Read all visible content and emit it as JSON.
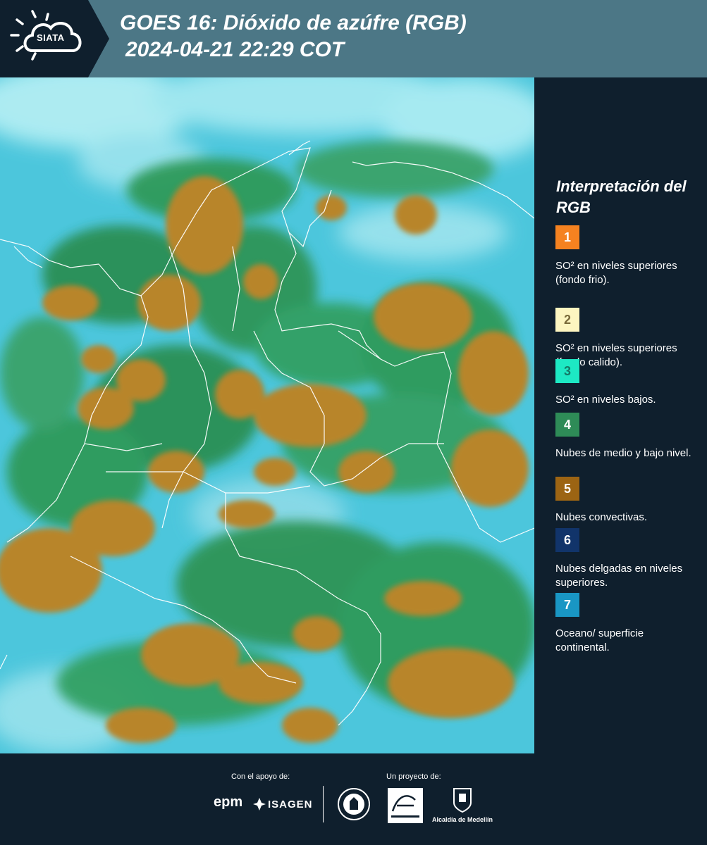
{
  "header": {
    "logo_text": "SIATA",
    "title_line_1": "GOES 16: Dióxido de azúfre (RGB)",
    "title_line_2": "2024-04-21 22:29 COT",
    "colors": {
      "dark": "#0f1f2d",
      "bar": "#4c7786"
    }
  },
  "map": {
    "product": "GOES-16 SO2 RGB composite",
    "dominant_colors": {
      "ocean_surface": "#5fd3e6",
      "mid_low_clouds": "#2f9a5a",
      "convective_clouds": "#b8852c"
    }
  },
  "legend": {
    "title": "Interpretación del RGB",
    "items": [
      {
        "number": "1",
        "color": "#f58220",
        "number_color": "#ffffff",
        "text": "SO² en niveles superiores (fondo frio)."
      },
      {
        "number": "2",
        "color": "#fdf5c0",
        "number_color": "#7a6a3a",
        "text": "SO² en niveles superiores (fondo calido)."
      },
      {
        "number": "3",
        "color": "#1de9c4",
        "number_color": "#147a66",
        "text": "SO² en niveles bajos."
      },
      {
        "number": "4",
        "color": "#2e8b57",
        "number_color": "#ffffff",
        "text": "Nubes de medio y bajo nivel."
      },
      {
        "number": "5",
        "color": "#9c6413",
        "number_color": "#ffffff",
        "text": "Nubes convectivas."
      },
      {
        "number": "6",
        "color": "#11346a",
        "number_color": "#ffffff",
        "text": "Nubes delgadas en niveles superiores."
      },
      {
        "number": "7",
        "color": "#1996c4",
        "number_color": "#ffffff",
        "text": "Oceano/ superficie continental."
      }
    ]
  },
  "footer": {
    "support_label": "Con el apoyo de:",
    "project_label": "Un proyecto de:",
    "epm_text": "epm",
    "isagen_text": "ISAGEN",
    "alcaldia_text": "Alcaldía de Medellín"
  }
}
